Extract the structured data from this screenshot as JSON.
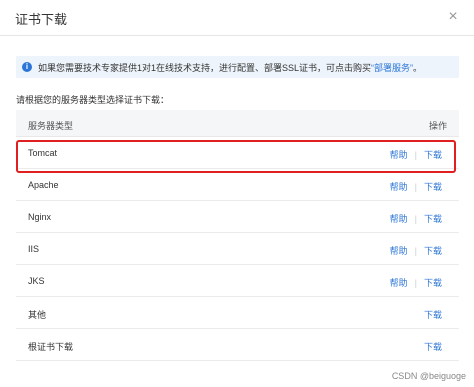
{
  "dialog": {
    "title": "证书下载",
    "close_glyph": "×"
  },
  "notice": {
    "icon": "info-icon",
    "text": "如果您需要技术专家提供1对1在线技术支持，进行配置、部署SSL证书，可点击购买",
    "link": "“部署服务”",
    "suffix": "。"
  },
  "instruction": "请根据您的服务器类型选择证书下载：",
  "table": {
    "headers": {
      "type": "服务器类型",
      "action": "操作"
    },
    "rows": [
      {
        "name": "Tomcat",
        "help": "帮助",
        "download": "下载"
      },
      {
        "name": "Apache",
        "help": "帮助",
        "download": "下载"
      },
      {
        "name": "Nginx",
        "help": "帮助",
        "download": "下载"
      },
      {
        "name": "IIS",
        "help": "帮助",
        "download": "下载"
      },
      {
        "name": "JKS",
        "help": "帮助",
        "download": "下载"
      },
      {
        "name": "其他",
        "help": "",
        "download": "下载"
      },
      {
        "name": "根证书下载",
        "help": "",
        "download": "下载"
      }
    ]
  },
  "watermark": "CSDN @beiguoge",
  "colors": {
    "accent": "#2b76d6",
    "highlight": "#e02020"
  }
}
